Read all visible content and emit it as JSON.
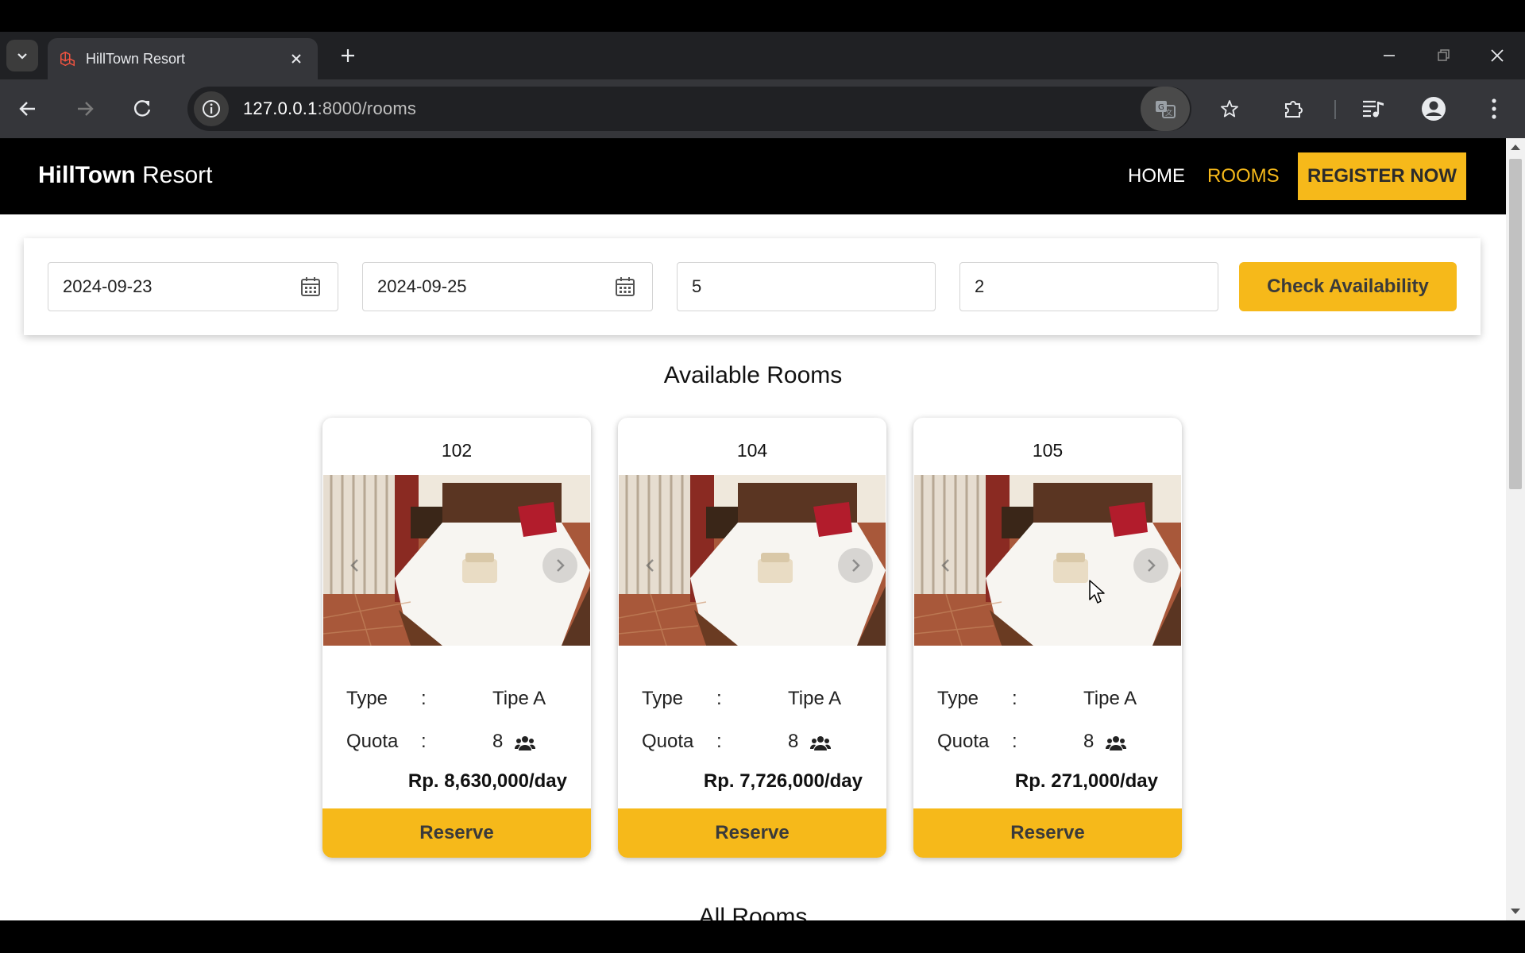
{
  "browser": {
    "tab_title": "HillTown Resort",
    "url_host": "127.0.0.1",
    "url_path": ":8000/rooms",
    "icons": [
      "tab-dropdown-icon",
      "favicon-icon",
      "close-icon",
      "plus-icon",
      "minimize-icon",
      "restore-icon",
      "close-window-icon",
      "back-icon",
      "forward-icon",
      "reload-icon",
      "info-icon",
      "translate-icon",
      "star-icon",
      "extensions-icon",
      "media-icon",
      "profile-icon",
      "menu-icon"
    ]
  },
  "header": {
    "brand_bold": "HillTown",
    "brand_light": " Resort",
    "nav_home": "HOME",
    "nav_rooms": "ROOMS",
    "register": "REGISTER NOW",
    "accent_color": "#f6b91a"
  },
  "search": {
    "check_in": "2024-09-23",
    "check_out": "2024-09-25",
    "guests": "5",
    "rooms": "2",
    "button": "Check Availability"
  },
  "available_title": "Available Rooms",
  "all_rooms_title": "All Rooms",
  "labels": {
    "type": "Type",
    "quota": "Quota",
    "colon": ":",
    "reserve": "Reserve"
  },
  "rooms": [
    {
      "number": "102",
      "type": "Tipe A",
      "quota": "8",
      "price": "Rp. 8,630,000/day"
    },
    {
      "number": "104",
      "type": "Tipe A",
      "quota": "8",
      "price": "Rp. 7,726,000/day"
    },
    {
      "number": "105",
      "type": "Tipe A",
      "quota": "8",
      "price": "Rp. 271,000/day"
    }
  ]
}
